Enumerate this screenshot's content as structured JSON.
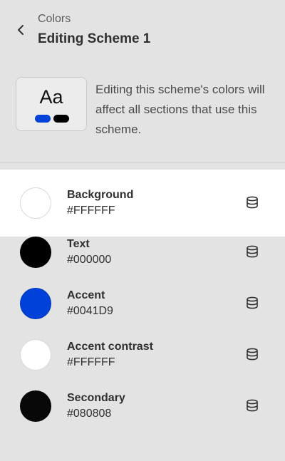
{
  "header": {
    "subtitle": "Colors",
    "title": "Editing Scheme 1"
  },
  "preview": {
    "sample_text": "Aa",
    "accent_color": "#0041D9",
    "dark_color": "#000000"
  },
  "description": "Editing this scheme's colors will affect all sections that use this scheme.",
  "colors": [
    {
      "label": "Background",
      "hex": "#FFFFFF",
      "swatch": "#FFFFFF",
      "selected": true
    },
    {
      "label": "Text",
      "hex": "#000000",
      "swatch": "#000000",
      "selected": false
    },
    {
      "label": "Accent",
      "hex": "#0041D9",
      "swatch": "#0041D9",
      "selected": false
    },
    {
      "label": "Accent contrast",
      "hex": "#FFFFFF",
      "swatch": "#FFFFFF",
      "selected": false
    },
    {
      "label": "Secondary",
      "hex": "#080808",
      "swatch": "#080808",
      "selected": false
    }
  ],
  "icons": {
    "back": "chevron-left-icon",
    "connect": "database-icon"
  }
}
